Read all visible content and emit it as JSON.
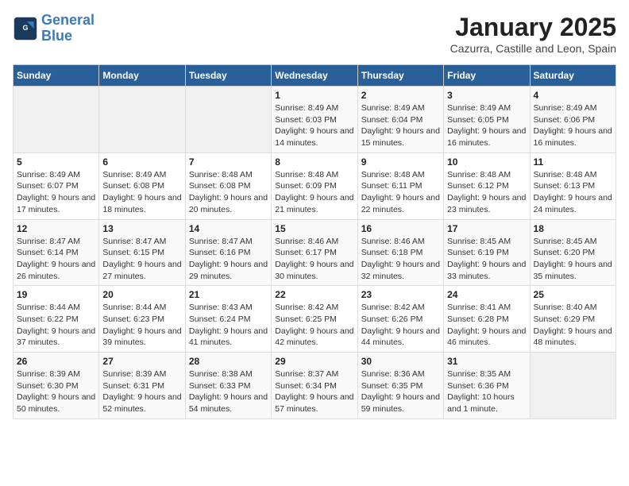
{
  "header": {
    "logo_line1": "General",
    "logo_line2": "Blue",
    "month_title": "January 2025",
    "subtitle": "Cazurra, Castille and Leon, Spain"
  },
  "weekdays": [
    "Sunday",
    "Monday",
    "Tuesday",
    "Wednesday",
    "Thursday",
    "Friday",
    "Saturday"
  ],
  "weeks": [
    [
      {
        "day": "",
        "info": ""
      },
      {
        "day": "",
        "info": ""
      },
      {
        "day": "",
        "info": ""
      },
      {
        "day": "1",
        "info": "Sunrise: 8:49 AM\nSunset: 6:03 PM\nDaylight: 9 hours and 14 minutes."
      },
      {
        "day": "2",
        "info": "Sunrise: 8:49 AM\nSunset: 6:04 PM\nDaylight: 9 hours and 15 minutes."
      },
      {
        "day": "3",
        "info": "Sunrise: 8:49 AM\nSunset: 6:05 PM\nDaylight: 9 hours and 16 minutes."
      },
      {
        "day": "4",
        "info": "Sunrise: 8:49 AM\nSunset: 6:06 PM\nDaylight: 9 hours and 16 minutes."
      }
    ],
    [
      {
        "day": "5",
        "info": "Sunrise: 8:49 AM\nSunset: 6:07 PM\nDaylight: 9 hours and 17 minutes."
      },
      {
        "day": "6",
        "info": "Sunrise: 8:49 AM\nSunset: 6:08 PM\nDaylight: 9 hours and 18 minutes."
      },
      {
        "day": "7",
        "info": "Sunrise: 8:48 AM\nSunset: 6:08 PM\nDaylight: 9 hours and 20 minutes."
      },
      {
        "day": "8",
        "info": "Sunrise: 8:48 AM\nSunset: 6:09 PM\nDaylight: 9 hours and 21 minutes."
      },
      {
        "day": "9",
        "info": "Sunrise: 8:48 AM\nSunset: 6:11 PM\nDaylight: 9 hours and 22 minutes."
      },
      {
        "day": "10",
        "info": "Sunrise: 8:48 AM\nSunset: 6:12 PM\nDaylight: 9 hours and 23 minutes."
      },
      {
        "day": "11",
        "info": "Sunrise: 8:48 AM\nSunset: 6:13 PM\nDaylight: 9 hours and 24 minutes."
      }
    ],
    [
      {
        "day": "12",
        "info": "Sunrise: 8:47 AM\nSunset: 6:14 PM\nDaylight: 9 hours and 26 minutes."
      },
      {
        "day": "13",
        "info": "Sunrise: 8:47 AM\nSunset: 6:15 PM\nDaylight: 9 hours and 27 minutes."
      },
      {
        "day": "14",
        "info": "Sunrise: 8:47 AM\nSunset: 6:16 PM\nDaylight: 9 hours and 29 minutes."
      },
      {
        "day": "15",
        "info": "Sunrise: 8:46 AM\nSunset: 6:17 PM\nDaylight: 9 hours and 30 minutes."
      },
      {
        "day": "16",
        "info": "Sunrise: 8:46 AM\nSunset: 6:18 PM\nDaylight: 9 hours and 32 minutes."
      },
      {
        "day": "17",
        "info": "Sunrise: 8:45 AM\nSunset: 6:19 PM\nDaylight: 9 hours and 33 minutes."
      },
      {
        "day": "18",
        "info": "Sunrise: 8:45 AM\nSunset: 6:20 PM\nDaylight: 9 hours and 35 minutes."
      }
    ],
    [
      {
        "day": "19",
        "info": "Sunrise: 8:44 AM\nSunset: 6:22 PM\nDaylight: 9 hours and 37 minutes."
      },
      {
        "day": "20",
        "info": "Sunrise: 8:44 AM\nSunset: 6:23 PM\nDaylight: 9 hours and 39 minutes."
      },
      {
        "day": "21",
        "info": "Sunrise: 8:43 AM\nSunset: 6:24 PM\nDaylight: 9 hours and 41 minutes."
      },
      {
        "day": "22",
        "info": "Sunrise: 8:42 AM\nSunset: 6:25 PM\nDaylight: 9 hours and 42 minutes."
      },
      {
        "day": "23",
        "info": "Sunrise: 8:42 AM\nSunset: 6:26 PM\nDaylight: 9 hours and 44 minutes."
      },
      {
        "day": "24",
        "info": "Sunrise: 8:41 AM\nSunset: 6:28 PM\nDaylight: 9 hours and 46 minutes."
      },
      {
        "day": "25",
        "info": "Sunrise: 8:40 AM\nSunset: 6:29 PM\nDaylight: 9 hours and 48 minutes."
      }
    ],
    [
      {
        "day": "26",
        "info": "Sunrise: 8:39 AM\nSunset: 6:30 PM\nDaylight: 9 hours and 50 minutes."
      },
      {
        "day": "27",
        "info": "Sunrise: 8:39 AM\nSunset: 6:31 PM\nDaylight: 9 hours and 52 minutes."
      },
      {
        "day": "28",
        "info": "Sunrise: 8:38 AM\nSunset: 6:33 PM\nDaylight: 9 hours and 54 minutes."
      },
      {
        "day": "29",
        "info": "Sunrise: 8:37 AM\nSunset: 6:34 PM\nDaylight: 9 hours and 57 minutes."
      },
      {
        "day": "30",
        "info": "Sunrise: 8:36 AM\nSunset: 6:35 PM\nDaylight: 9 hours and 59 minutes."
      },
      {
        "day": "31",
        "info": "Sunrise: 8:35 AM\nSunset: 6:36 PM\nDaylight: 10 hours and 1 minute."
      },
      {
        "day": "",
        "info": ""
      }
    ]
  ]
}
